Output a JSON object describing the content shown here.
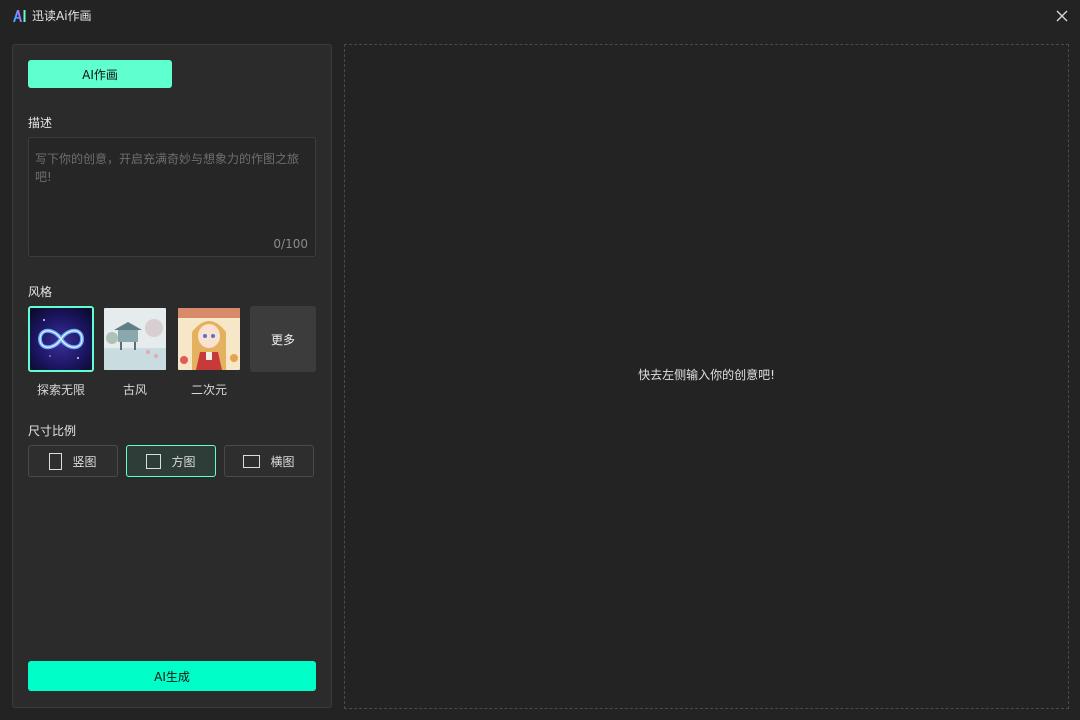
{
  "window": {
    "title": "迅读Ai作画",
    "logo_icon": "ai-logo-icon",
    "close_icon": "close-icon"
  },
  "left_panel": {
    "mode_tab_label": "AI作画",
    "description": {
      "label": "描述",
      "placeholder": "写下你的创意，开启充满奇妙与想象力的作图之旅吧!",
      "value": "",
      "char_count": "0/100"
    },
    "style": {
      "label": "风格",
      "items": [
        {
          "name": "探索无限",
          "selected": true
        },
        {
          "name": "古风",
          "selected": false
        },
        {
          "name": "二次元",
          "selected": false
        }
      ],
      "more_label": "更多"
    },
    "ratio": {
      "label": "尺寸比例",
      "options": [
        {
          "label": "竖图",
          "selected": false
        },
        {
          "label": "方图",
          "selected": true
        },
        {
          "label": "横图",
          "selected": false
        }
      ]
    },
    "generate_label": "AI生成"
  },
  "canvas": {
    "empty_hint": "快去左侧输入你的创意吧!"
  },
  "colors": {
    "accent": "#5fffcf",
    "generate": "#00ffc8",
    "background": "#232323",
    "panel": "#2b2b2b"
  }
}
